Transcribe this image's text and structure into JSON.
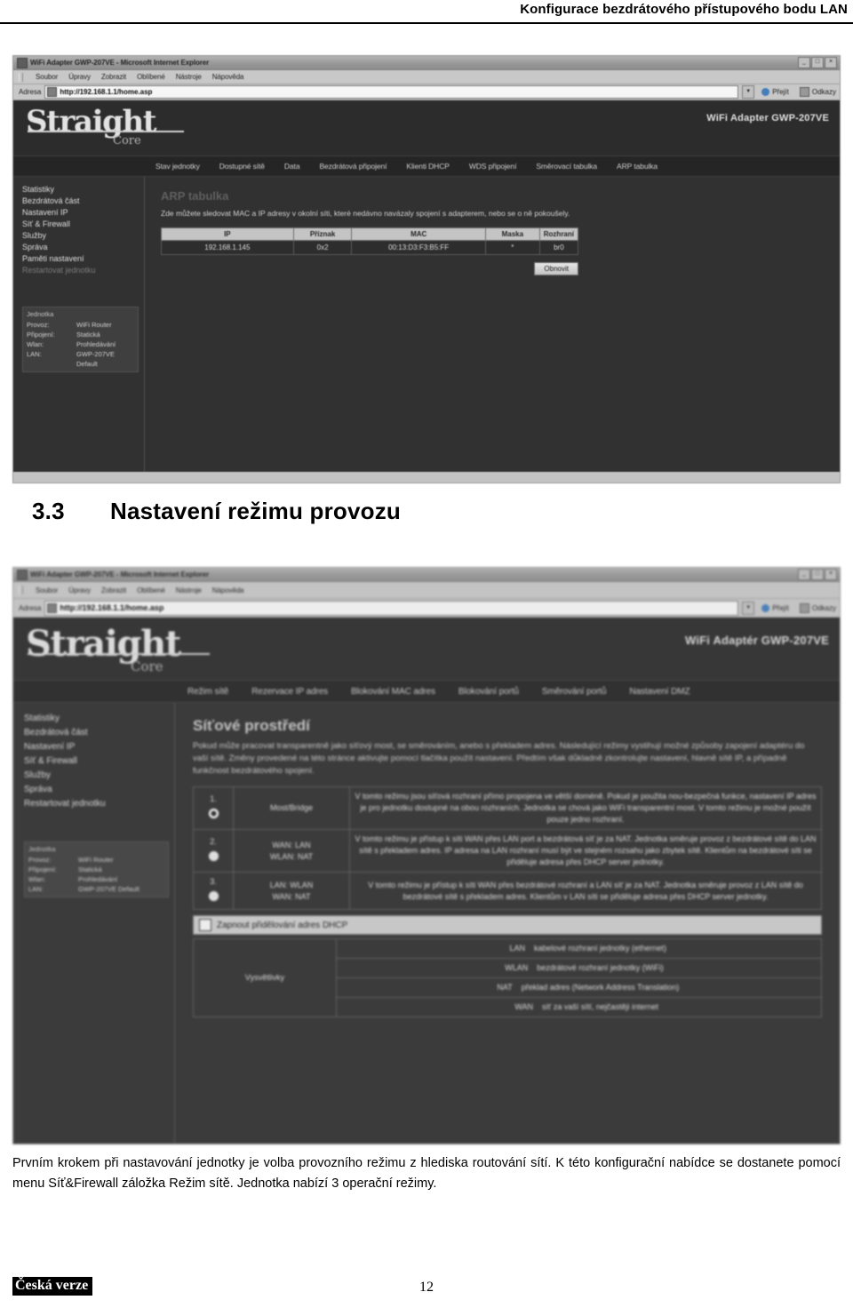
{
  "document": {
    "running_head": "Konfigurace bezdrátového přístupového bodu LAN",
    "section_number": "3.3",
    "section_title": "Nastavení režimu provozu",
    "paragraph": "Prvním krokem při nastavování jednotky je volba provozního režimu z hlediska routování sítí. K této konfigurační nabídce se dostanete pomocí menu Síť&Firewall záložka Režim sítě. Jednotka nabízí 3 operační režimy.",
    "footer_badge": "Česká verze",
    "page_number": "12"
  },
  "screenshot1": {
    "window_title": "WiFi Adapter GWP-207VE - Microsoft Internet Explorer",
    "window_buttons": [
      "_",
      "□",
      "×"
    ],
    "menu": [
      "Soubor",
      "Úpravy",
      "Zobrazit",
      "Oblíbené",
      "Nástroje",
      "Nápověda"
    ],
    "address": {
      "label": "Adresa",
      "value": "http://192.168.1.1/home.asp",
      "go_label": "Přejít",
      "links_label": "Odkazy"
    },
    "brand": {
      "name": "Straight",
      "sub": "Core",
      "model": "WiFi Adapter GWP-207VE"
    },
    "nav": [
      "Stav jednotky",
      "Dostupné sítě",
      "Data",
      "Bezdrátová připojení",
      "Klienti DHCP",
      "WDS připojení",
      "Směrovací tabulka",
      "ARP tabulka"
    ],
    "sidebar": [
      "Statistiky",
      "Bezdrátová část",
      "Nastavení IP",
      "Síť & Firewall",
      "Služby",
      "Správa",
      "Paměti nastavení",
      "Restartovat jednotku"
    ],
    "sidebar_info": {
      "title": "Jednotka",
      "rows": [
        {
          "key": "Provoz:",
          "value": "WiFi Router"
        },
        {
          "key": "Připojení:",
          "value": "Statická"
        },
        {
          "key": "Wlan:",
          "value": "Prohledávání"
        },
        {
          "key": "LAN:",
          "value": "GWP-207VE Default"
        }
      ]
    },
    "content": {
      "heading": "ARP tabulka",
      "description": "Zde můžete sledovat MAC a IP adresy v okolní síti, které nedávno navázaly spojení s adapterem, nebo se o ně pokoušely.",
      "table_headers": [
        "IP",
        "Příznak",
        "MAC",
        "Maska",
        "Rozhraní"
      ],
      "table_rows": [
        [
          "192.168.1.145",
          "0x2",
          "00:13:D3:F3:B5:FF",
          "*",
          "br0"
        ]
      ],
      "refresh_button": "Obnovit"
    }
  },
  "screenshot2": {
    "window_title": "WiFi Adapter GWP-207VE - Microsoft Internet Explorer",
    "window_buttons": [
      "_",
      "□",
      "×"
    ],
    "menu": [
      "Soubor",
      "Úpravy",
      "Zobrazit",
      "Oblíbené",
      "Nástroje",
      "Nápověda"
    ],
    "address": {
      "label": "Adresa",
      "value": "http://192.168.1.1/home.asp",
      "go_label": "Přejít",
      "links_label": "Odkazy"
    },
    "brand": {
      "name": "Straight",
      "sub": "Core",
      "model": "WiFi Adaptér GWP-207VE"
    },
    "nav": [
      "Režim sítě",
      "Rezervace IP adres",
      "Blokování MAC adres",
      "Blokování portů",
      "Směrování portů",
      "Nastavení DMZ"
    ],
    "sidebar": [
      "Statistiky",
      "Bezdrátová část",
      "Nastavení IP",
      "Síť & Firewall",
      "Služby",
      "Správa",
      "Restartovat jednotku"
    ],
    "content": {
      "heading": "Síťové prostředí",
      "description": "Pokud může pracovat transparentně jako síťový most, se směrováním, anebo s překladem adres. Následující režimy vystihují možné způsoby zapojení adaptéru do vaší sítě. Změny provedené na této stránce aktivujte pomocí tlačítka použít nastavení. Předtím však důkladně zkontrolujte nastavení, hlavně sítě IP, a případně funkčnost bezdrátového spojení.",
      "modes": [
        {
          "num": "1.",
          "selected": true,
          "label": "Most/Bridge",
          "text": "V tomto režimu jsou síťová rozhraní přímo propojena ve větší doméně. Pokud je použita nou-bezpečná funkce, nastavení IP adres je pro jednotku dostupné na obou rozhraních. Jednotka se chová jako WiFi transparentní most. V tomto režimu je možné použít pouze jedno rozhraní."
        },
        {
          "num": "2.",
          "selected": false,
          "label": "WAN: LAN\nWLAN: NAT",
          "text": "V tomto režimu je přístup k síti WAN přes LAN port a bezdrátová síť je za NAT. Jednotka směruje provoz z bezdrátové sítě do LAN sítě s překladem adres. IP adresa na LAN rozhraní musí být ve stejném rozsahu jako zbytek sítě. Klientům na bezdrátové síti se přiděluje adresa přes DHCP server jednotky."
        },
        {
          "num": "3.",
          "selected": false,
          "label": "LAN: WLAN\nWAN: NAT",
          "text": "V tomto režimu je přístup k síti WAN přes bezdrátové rozhraní a LAN síť je za NAT. Jednotka směruje provoz z LAN sítě do bezdrátové sítě s překladem adres. Klientům v LAN síti se přiděluje adresa přes DHCP server jednotky."
        }
      ],
      "dhcp_checkbox": {
        "checked": false,
        "label": "Zapnout přidělování adres DHCP"
      },
      "legend": {
        "label": "Vysvětlivky",
        "rows": [
          {
            "key": "LAN",
            "value": "kabelové rozhraní jednotky (ethernet)"
          },
          {
            "key": "WLAN",
            "value": "bezdrátové rozhraní jednotky (WiFi)"
          },
          {
            "key": "NAT",
            "value": "překlad adres (Network Address Translation)"
          },
          {
            "key": "WAN",
            "value": "síť za vaší sítí, nejčastěji internet"
          }
        ]
      }
    }
  }
}
